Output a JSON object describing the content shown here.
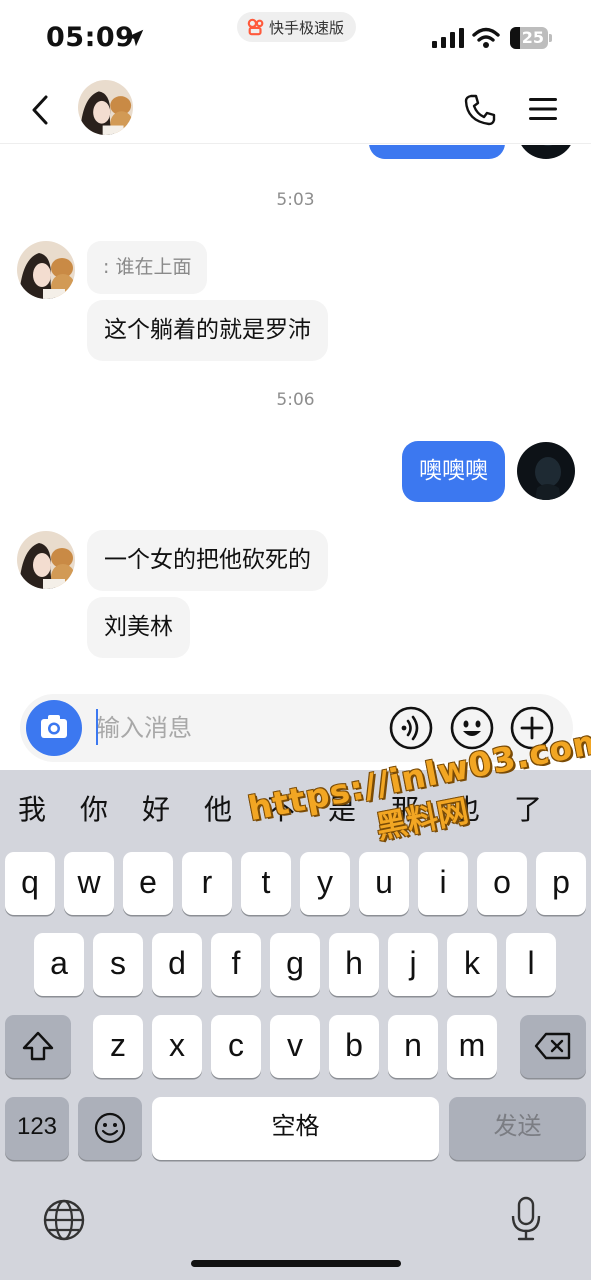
{
  "status_bar": {
    "time": "05:09",
    "app_pill_label": "快手极速版",
    "battery_level": "25",
    "battery_fraction": 0.25,
    "icons": [
      "location-arrow-icon",
      "signal-icon",
      "wifi-icon",
      "battery-icon"
    ]
  },
  "header": {
    "icons": [
      "chevron-left-icon",
      "avatar",
      "phone-icon",
      "menu-icon"
    ]
  },
  "messages": {
    "timestamp_1": "5:03",
    "quote_text": ": 谁在上面",
    "msg_1": "这个躺着的就是罗沛",
    "timestamp_2": "5:06",
    "msg_out_1": "噢噢噢",
    "msg_2": "一个女的把他砍死的",
    "msg_3": "刘美林"
  },
  "input_bar": {
    "placeholder": "输入消息",
    "icons": [
      "camera-icon",
      "voice-icon",
      "emoji-icon",
      "plus-icon"
    ]
  },
  "keyboard": {
    "suggestions": [
      "我",
      "你",
      "好",
      "他",
      "不",
      "是",
      "那",
      "也",
      "了"
    ],
    "row1": [
      "q",
      "w",
      "e",
      "r",
      "t",
      "y",
      "u",
      "i",
      "o",
      "p"
    ],
    "row2": [
      "a",
      "s",
      "d",
      "f",
      "g",
      "h",
      "j",
      "k",
      "l"
    ],
    "row3": [
      "z",
      "x",
      "c",
      "v",
      "b",
      "n",
      "m"
    ],
    "numbers_label": "123",
    "space_label": "空格",
    "send_label": "发送",
    "icons": [
      "shift-icon",
      "backspace-icon",
      "emoji-key-icon",
      "globe-icon",
      "microphone-icon"
    ]
  },
  "watermark": {
    "url": "https://inlw03.com",
    "site": "黑料网"
  },
  "colors": {
    "accent": "#3c78f0",
    "incoming_bubble": "#f4f4f4",
    "keyboard_bg": "#d3d5dc"
  }
}
